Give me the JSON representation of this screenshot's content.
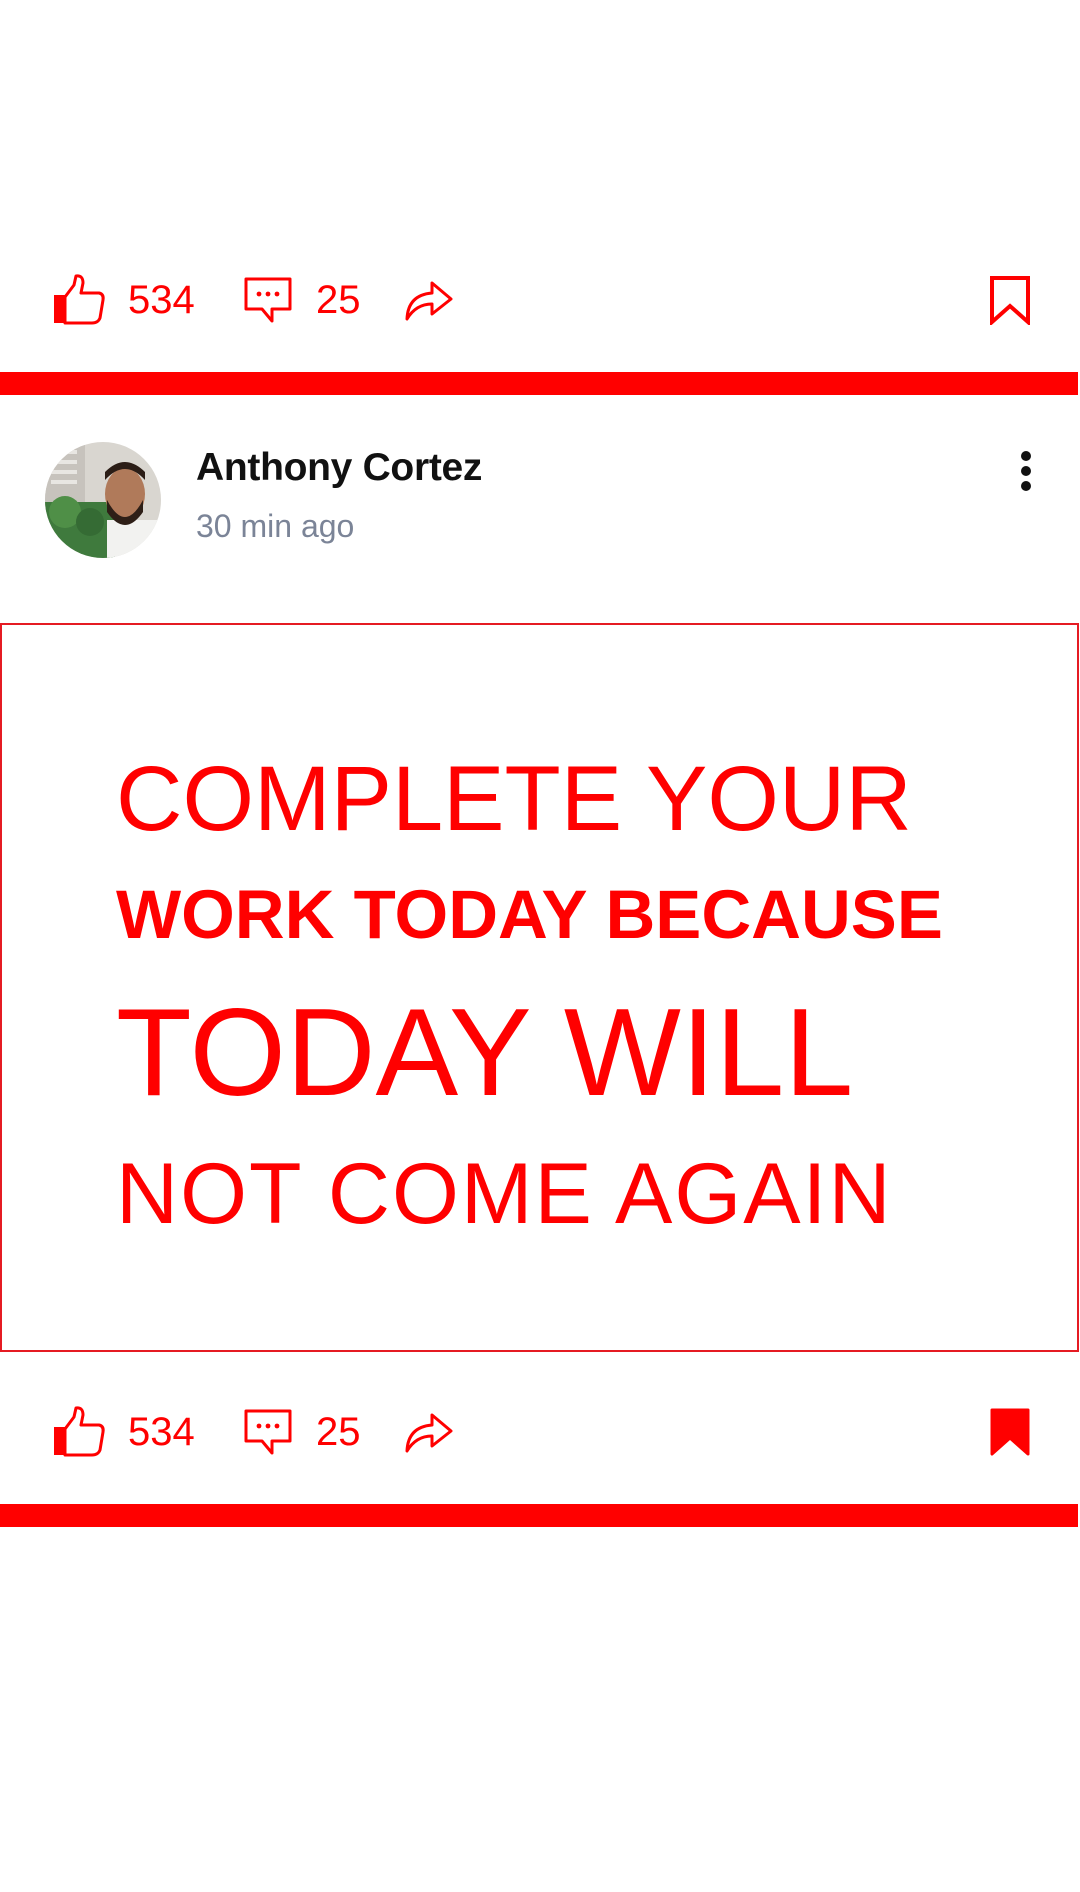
{
  "colors": {
    "accent": "#ff0000",
    "card_border": "#e51b23",
    "author_name": "#111111",
    "timestamp": "#7b8497",
    "background": "#ffffff"
  },
  "top_actions": {
    "like_count": "534",
    "comment_count": "25",
    "icons": [
      "thumbs-up-icon",
      "comment-icon",
      "share-icon",
      "bookmark-outline-icon"
    ]
  },
  "post": {
    "author": "Anthony Cortez",
    "time": "30 min ago",
    "quote_lines": [
      "COMPLETE YOUR",
      "WORK TODAY BECAUSE",
      "TODAY WILL",
      "NOT COME AGAIN"
    ]
  },
  "bottom_actions": {
    "like_count": "534",
    "comment_count": "25",
    "icons": [
      "thumbs-up-icon",
      "comment-icon",
      "share-icon",
      "bookmark-filled-icon"
    ]
  }
}
